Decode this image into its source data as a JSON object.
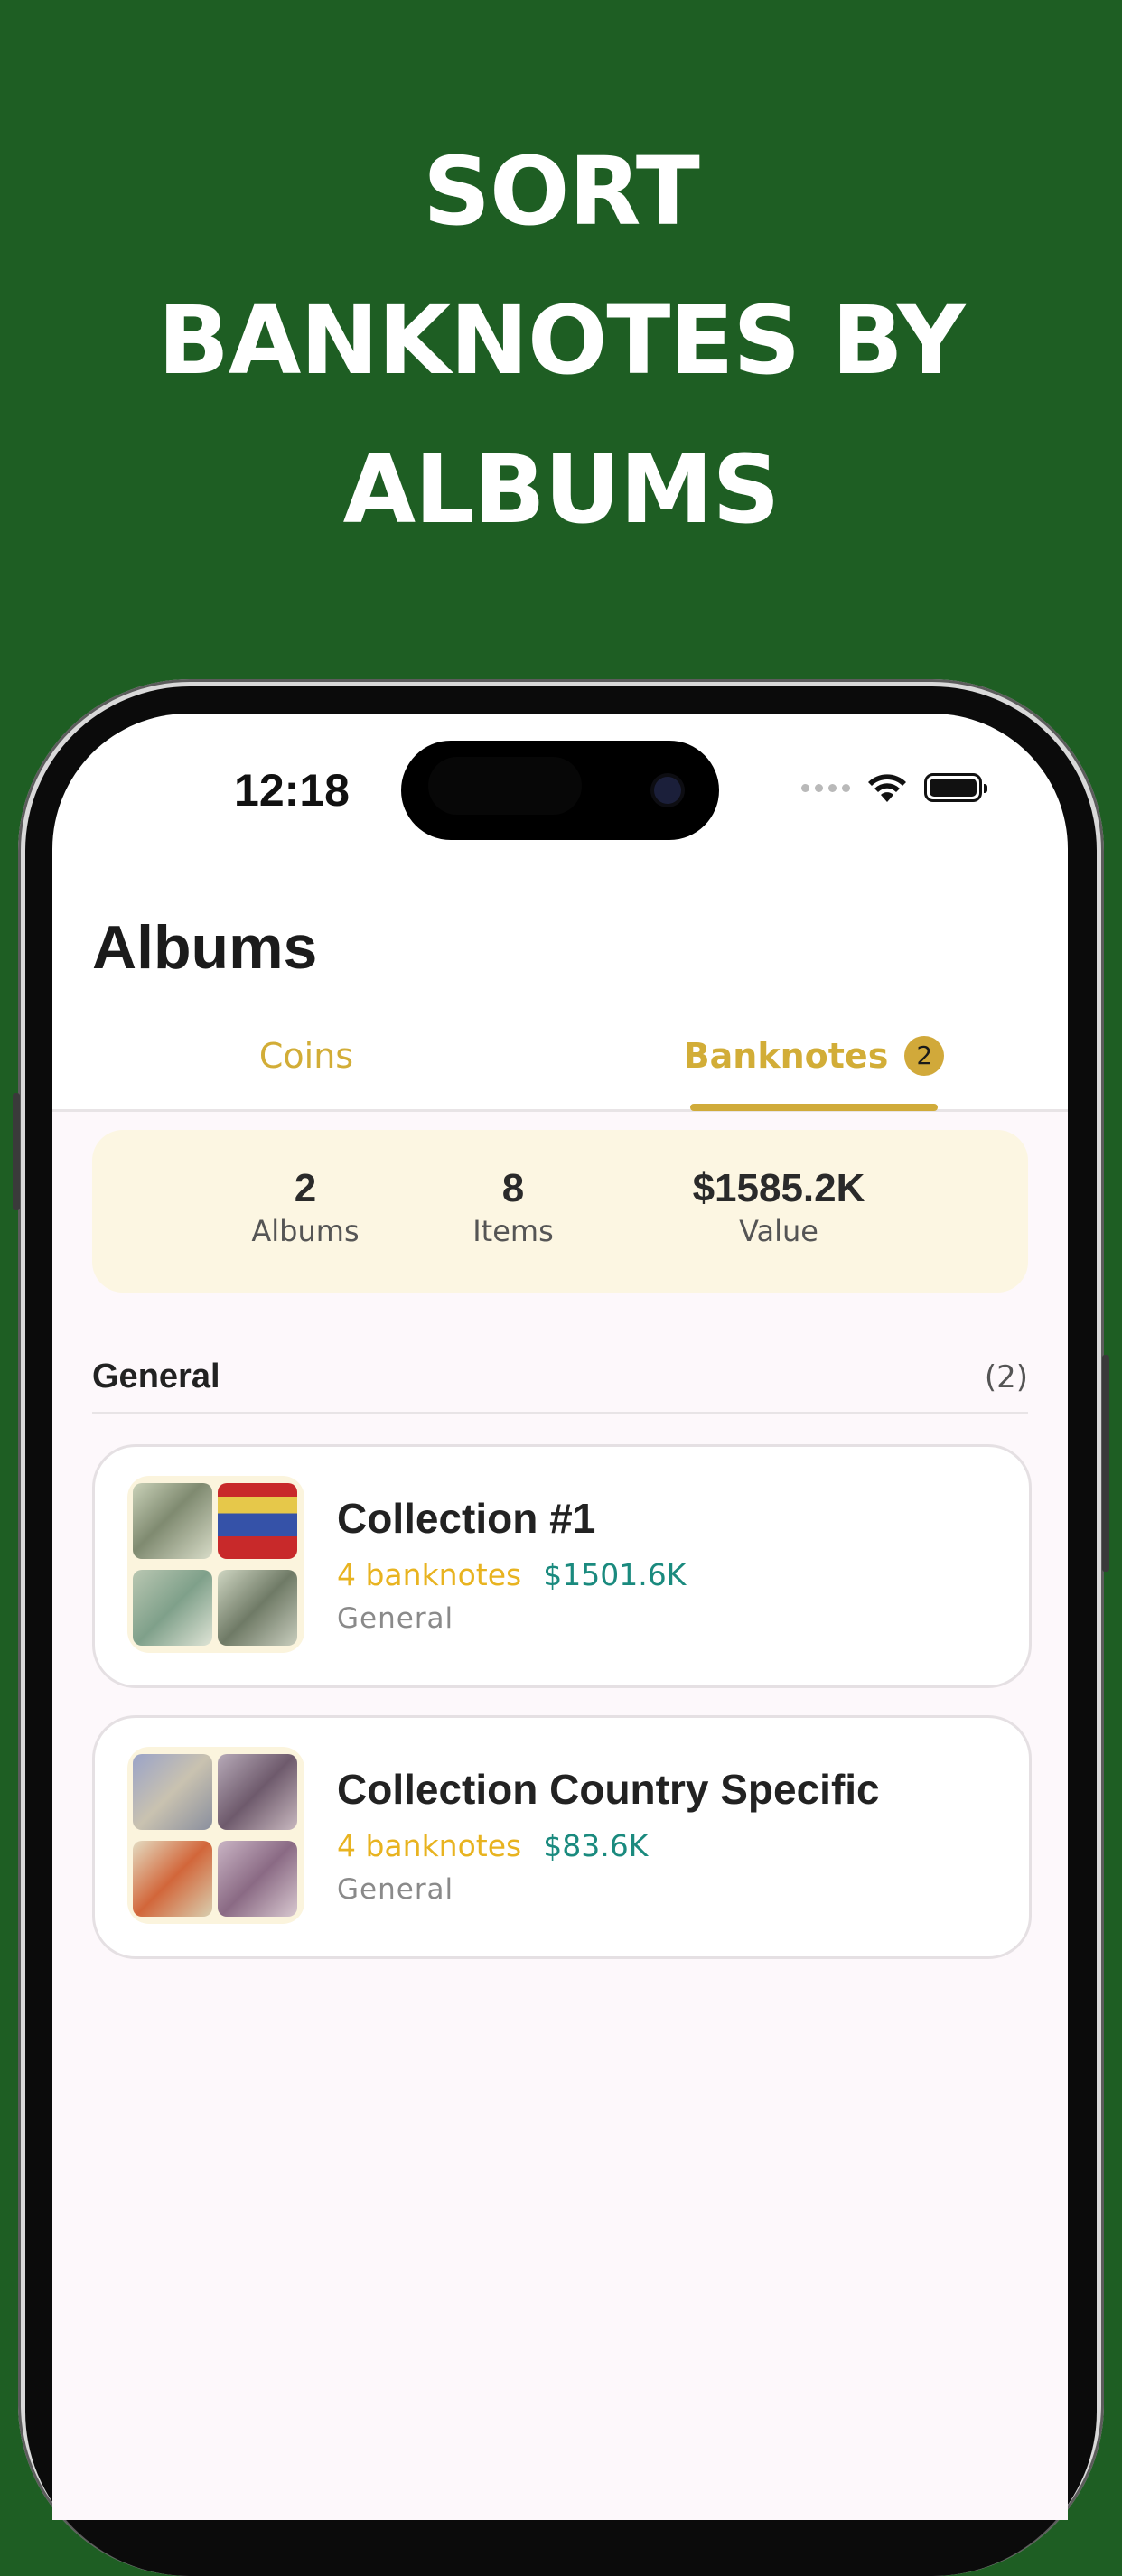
{
  "headline": {
    "line1": "SORT",
    "line2": "BANKNOTES BY",
    "line3": "ALBUMS"
  },
  "status_bar": {
    "time": "12:18"
  },
  "page": {
    "title": "Albums"
  },
  "tabs": [
    {
      "label": "Coins",
      "active": false
    },
    {
      "label": "Banknotes",
      "active": true,
      "badge": "2"
    }
  ],
  "stats": {
    "albums": {
      "value": "2",
      "label": "Albums"
    },
    "items": {
      "value": "8",
      "label": "Items"
    },
    "value": {
      "value": "$1585.2K",
      "label": "Value"
    }
  },
  "section": {
    "title": "General",
    "count": "(2)"
  },
  "albums": [
    {
      "name": "Collection #1",
      "count": "4 banknotes",
      "value": "$1501.6K",
      "category": "General"
    },
    {
      "name": "Collection Country Specific",
      "count": "4 banknotes",
      "value": "$83.6K",
      "category": "General"
    }
  ],
  "colors": {
    "brand_green": "#1e5e23",
    "accent_gold": "#d2ad37",
    "count_yellow": "#e8b320",
    "value_teal": "#1a8a7e"
  }
}
